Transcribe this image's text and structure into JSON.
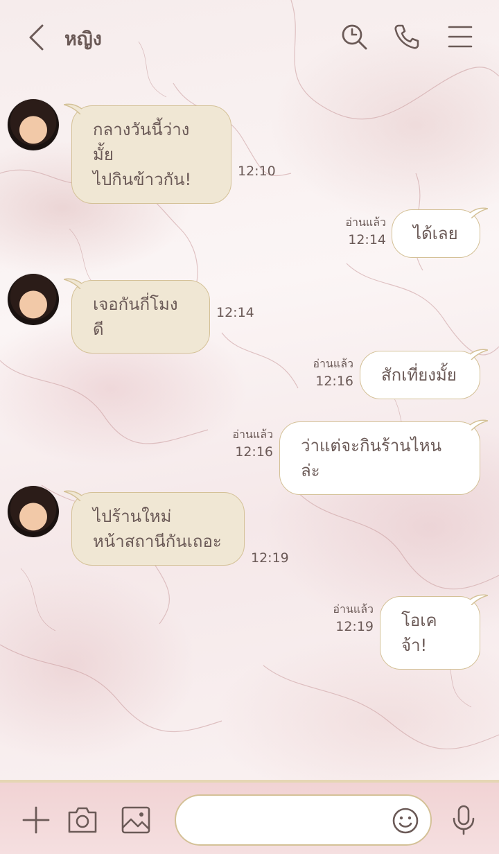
{
  "header": {
    "title": "หญิง",
    "back_icon": "chevron-left-icon",
    "actions": [
      "search-icon",
      "phone-icon",
      "menu-icon"
    ]
  },
  "messages": [
    {
      "side": "in",
      "lines": [
        "กลางวันนี้ว่างมั้ย",
        "ไปกินข้าวกัน!"
      ],
      "time": "12:10"
    },
    {
      "side": "out",
      "lines": [
        "ได้เลย"
      ],
      "read": "อ่านแล้ว",
      "time": "12:14"
    },
    {
      "side": "in",
      "lines": [
        "เจอกันกี่โมงดี"
      ],
      "time": "12:14"
    },
    {
      "side": "out",
      "lines": [
        "สักเที่ยงมั้ย"
      ],
      "read": "อ่านแล้ว",
      "time": "12:16"
    },
    {
      "side": "out",
      "lines": [
        "ว่าแต่จะกินร้านไหนล่ะ"
      ],
      "read": "อ่านแล้ว",
      "time": "12:16"
    },
    {
      "side": "in",
      "lines": [
        "ไปร้านใหม่",
        "หน้าสถานีกันเถอะ"
      ],
      "time": "12:19"
    },
    {
      "side": "out",
      "lines": [
        "โอเคจ้า!"
      ],
      "read": "อ่านแล้ว",
      "time": "12:19"
    }
  ],
  "composer": {
    "input_value": "",
    "icons": [
      "plus-icon",
      "camera-icon",
      "image-icon",
      "emoji-icon",
      "microphone-icon"
    ]
  },
  "colors": {
    "text": "#6b5a57",
    "bubble_in": "#f0e7d4",
    "bubble_out": "#ffffff",
    "bubble_border": "#d4c197",
    "composer_bg": "#f1d3d4",
    "composer_border": "#e5d6b4"
  }
}
